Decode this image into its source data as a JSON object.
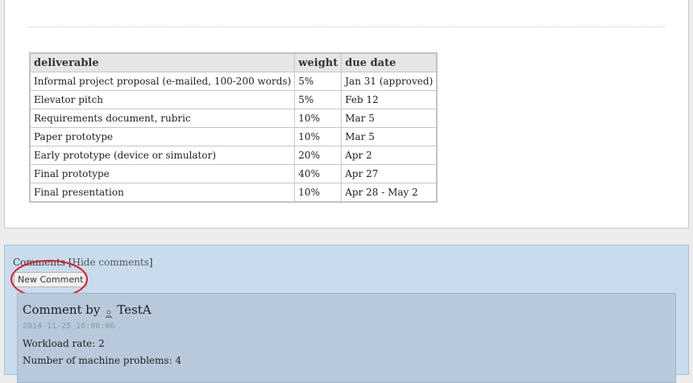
{
  "table": {
    "headers": [
      "deliverable",
      "weight",
      "due date"
    ],
    "rows": [
      [
        "Informal project proposal (e-mailed, 100-200 words)",
        "5%",
        "Jan 31 (approved)"
      ],
      [
        "Elevator pitch",
        "5%",
        "Feb 12"
      ],
      [
        "Requirements document, rubric",
        "10%",
        "Mar 5"
      ],
      [
        "Paper prototype",
        "10%",
        "Mar 5"
      ],
      [
        "Early prototype (device or simulator)",
        "20%",
        "Apr 2"
      ],
      [
        "Final prototype",
        "40%",
        "Apr 27"
      ],
      [
        "Final presentation",
        "10%",
        "Apr 28 - May 2"
      ]
    ]
  },
  "comments": {
    "header_label": "Comments",
    "open_bracket": "[",
    "hide_link": "Hide comments",
    "close_bracket": "]",
    "new_comment_button": "New Comment",
    "highlight_color": "#e0161e"
  },
  "comment": {
    "by_label": "Comment by",
    "author": "TestA",
    "author_icon": "user-icon",
    "timestamp": "2014-11-25 16:00:06",
    "workload": "Workload rate: 2",
    "machine_problems": "Number of machine problems: 4"
  }
}
